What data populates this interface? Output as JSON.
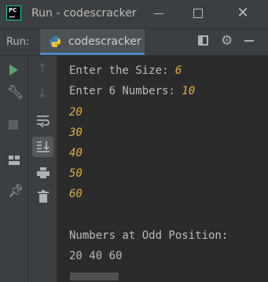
{
  "window": {
    "title": "Run - codescracker",
    "app_icon_text": "PC"
  },
  "toolstrip": {
    "run_label": "Run:",
    "tab_label": "codescracker"
  },
  "colors": {
    "background": "#2b2b2b",
    "panel": "#3c3f41",
    "text": "#bbbbbb",
    "user_input": "#e0b04a",
    "run_green": "#59a869",
    "tab_accent": "#4a88c7"
  },
  "console": {
    "prompt_size": "Enter the Size: ",
    "input_size": "6",
    "prompt_numbers": "Enter 6 Numbers: ",
    "inputs": [
      "10",
      "20",
      "30",
      "40",
      "50",
      "60"
    ],
    "result_label": "Numbers at Odd Position:",
    "result_values": "20 40 60"
  },
  "icons": {
    "sidebar_left": [
      "run-icon",
      "wrench-icon",
      "stop-icon",
      "layout-panel-icon",
      "pin-icon"
    ],
    "sidebar_right": [
      "up-arrow-icon",
      "down-arrow-icon",
      "soft-wrap-icon",
      "scroll-to-end-icon",
      "print-icon",
      "trash-icon"
    ],
    "toolbar": [
      "restore-layout-icon",
      "gear-icon",
      "hide-icon"
    ]
  }
}
